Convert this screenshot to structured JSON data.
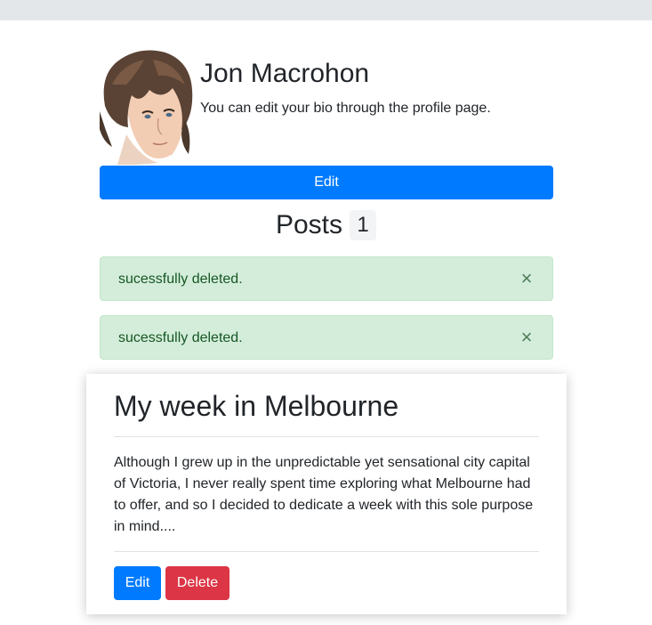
{
  "profile": {
    "name": "Jon Macrohon",
    "bio": "You can edit your bio through the profile page.",
    "edit_label": "Edit"
  },
  "posts": {
    "title": "Posts",
    "count": "1"
  },
  "alerts": [
    {
      "message": "sucessfully deleted.",
      "close": "×"
    },
    {
      "message": "sucessfully deleted.",
      "close": "×"
    }
  ],
  "post": {
    "title": "My week in Melbourne",
    "body": "Although I grew up in the unpredictable yet sensational city capital of Victoria, I never really spent time exploring what Melbourne had to offer, and so I decided to dedicate a week with this sole purpose in mind....",
    "edit_label": "Edit",
    "delete_label": "Delete"
  },
  "colors": {
    "primary": "#007bff",
    "danger": "#dc3545",
    "success_bg": "#d4edda",
    "success_text": "#155724"
  }
}
